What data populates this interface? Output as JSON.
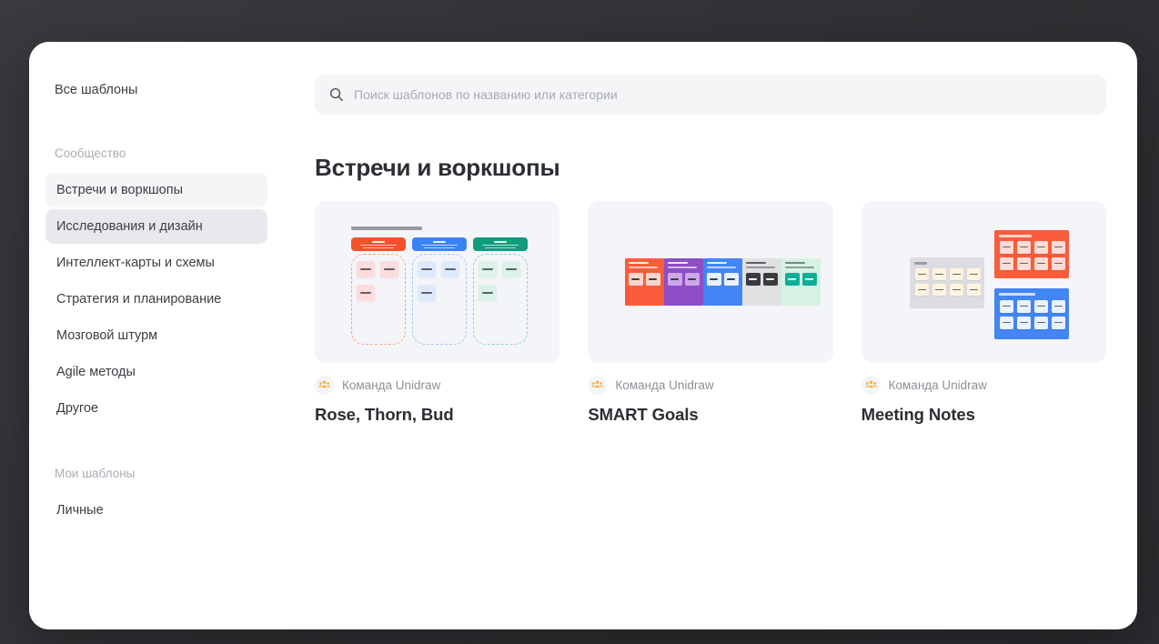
{
  "theme": {
    "backdrop": "#333438",
    "modal_bg": "#ffffff",
    "card_bg": "#f4f5f8",
    "muted_text": "#8b9096",
    "title_text": "#2b2e33",
    "accent_orange": "#fbb13c"
  },
  "sidebar": {
    "root_item": {
      "label": "Все шаблоны",
      "state": "default"
    },
    "sections": [
      {
        "label": "Сообщество",
        "items": [
          {
            "label": "Встречи и воркшопы",
            "state": "selected"
          },
          {
            "label": "Исследования и дизайн",
            "state": "hover"
          },
          {
            "label": "Интеллект-карты и схемы",
            "state": "default"
          },
          {
            "label": "Стратегия и планирование",
            "state": "default"
          },
          {
            "label": "Мозговой штурм",
            "state": "default"
          },
          {
            "label": "Agile методы",
            "state": "default"
          },
          {
            "label": "Другое",
            "state": "default"
          }
        ]
      },
      {
        "label": "Мои шаблоны",
        "items": [
          {
            "label": "Личные",
            "state": "default"
          }
        ]
      }
    ]
  },
  "search": {
    "icon": "search-icon",
    "placeholder": "Поиск шаблонов по названию или категории",
    "value": ""
  },
  "main": {
    "section_title": "Встречи и воркшопы",
    "cards": [
      {
        "title": "Rose, Thorn, Bud",
        "author": "Команда Unidraw",
        "author_icon": "group-people-icon",
        "thumb_kind": "rose-thorn-bud",
        "columns": [
          {
            "name": "Rose",
            "color": "#f4512c",
            "zone_border": "#f7a48e",
            "note_bg": "#fcdcdc"
          },
          {
            "name": "Thorn",
            "color": "#3b82f6",
            "zone_border": "#a9c6fb",
            "note_bg": "#dfe9fd"
          },
          {
            "name": "Bud",
            "color": "#0f9d7e",
            "zone_border": "#8fd5c6",
            "note_bg": "#dcf2e8"
          }
        ],
        "notes_per_column": 3
      },
      {
        "title": "SMART Goals",
        "author": "Команда Unidraw",
        "author_icon": "group-people-icon",
        "thumb_kind": "smart-goals",
        "blocks": [
          {
            "letter": "S",
            "color": "#fb5c3c",
            "title_color": "#ffffff",
            "note_bg": "#fbd5cc",
            "note_line": "#3c3f44"
          },
          {
            "letter": "M",
            "color": "#8e4ec6",
            "title_color": "#ffffff",
            "note_bg": "#cda6e8",
            "note_line": "#3c3f44"
          },
          {
            "letter": "A",
            "color": "#4285f4",
            "title_color": "#ffffff",
            "note_bg": "#e8f0fe",
            "note_line": "#3c3f44"
          },
          {
            "letter": "R",
            "color": "#e0e0e3",
            "title_color": "#3c3f44",
            "note_bg": "#3a3b3f",
            "note_line": "#ffffff"
          },
          {
            "letter": "T",
            "color": "#d6f2e3",
            "title_color": "#3c3f44",
            "note_bg": "#0fae96",
            "note_line": "#ffffff"
          }
        ]
      },
      {
        "title": "Meeting Notes",
        "author": "Команда Unidraw",
        "author_icon": "group-people-icon",
        "thumb_kind": "meeting-notes",
        "panels": [
          {
            "name": "agenda",
            "color": "#dcdde0",
            "title_color": "#9a9ca0",
            "note_bg": "#fdf3df",
            "notes": 8
          },
          {
            "name": "actions",
            "color": "#fb5c3c",
            "title_color": "#ffd7cc",
            "note_bg": "#fbdcd6",
            "notes": 8
          },
          {
            "name": "notes",
            "color": "#4285f4",
            "title_color": "#cfe0ff",
            "note_bg": "#eaf2ff",
            "notes": 8
          }
        ]
      }
    ]
  }
}
